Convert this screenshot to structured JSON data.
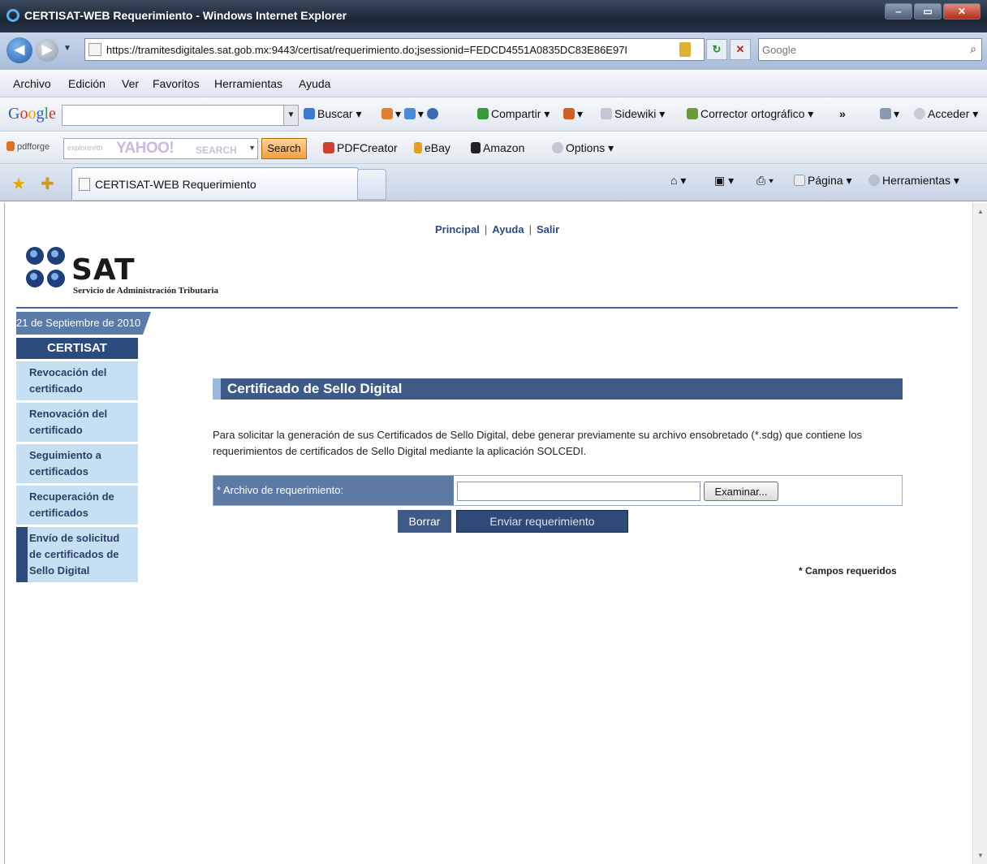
{
  "window": {
    "title": "CERTISAT-WEB Requerimiento - Windows Internet Explorer"
  },
  "address_bar": {
    "url": "https://tramitesdigitales.sat.gob.mx:9443/certisat/requerimiento.do;jsessionid=FEDCD4551A0835DC83E86E97I",
    "search_placeholder": "Google"
  },
  "menu": {
    "items": [
      "Archivo",
      "Edición",
      "Ver",
      "Favoritos",
      "Herramientas",
      "Ayuda"
    ]
  },
  "google_toolbar": {
    "logo": "Google",
    "buscar": "Buscar",
    "compartir": "Compartir",
    "sidewiki": "Sidewiki",
    "corrector": "Corrector ortográfico",
    "more": "»",
    "acceder": "Acceder"
  },
  "yahoo_toolbar": {
    "pdfforge": "pdfforge",
    "yahoo_prefix": "explorevith",
    "yahoo_logo": "YAHOO!",
    "yahoo_search": "SEARCH",
    "search_button": "Search",
    "pdfcreator": "PDFCreator",
    "ebay": "eBay",
    "amazon": "Amazon",
    "options": "Options"
  },
  "tabs": {
    "active_title": "CERTISAT-WEB Requerimiento",
    "pagina": "Página",
    "herramientas": "Herramientas"
  },
  "page": {
    "top_links": [
      "Principal",
      "Ayuda",
      "Salir"
    ],
    "separator": "|",
    "logo_text": "SAT",
    "logo_subtitle": "Servicio de Administración Tributaria",
    "date": "21 de Septiembre de 2010",
    "sidebar": {
      "heading": "CERTISAT",
      "items": [
        "Revocación del certificado",
        "Renovación del certificado",
        "Seguimiento a certificados",
        "Recuperación de certificados",
        "Envío de solicitud de certificados de Sello Digital"
      ]
    },
    "panel_title": "Certificado de Sello Digital",
    "description": "Para solicitar la generación de sus Certificados de Sello Digital, debe generar previamente su archivo ensobretado (*.sdg) que contiene los requerimientos de certificados de Sello Digital mediante la aplicación SOLCEDI.",
    "form": {
      "label": "* Archivo de requerimiento:",
      "browse": "Examinar...",
      "reset": "Borrar",
      "submit": "Enviar requerimiento"
    },
    "required_note": "* Campos requeridos"
  }
}
